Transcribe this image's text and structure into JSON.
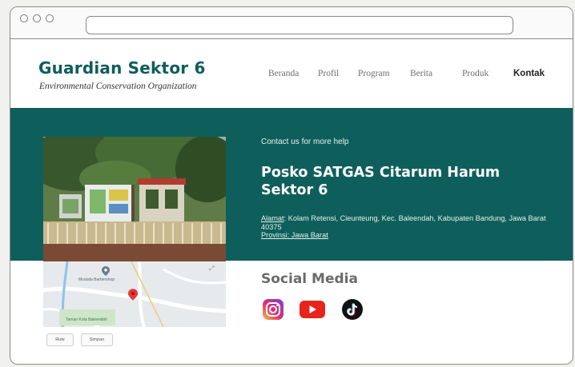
{
  "browser": {
    "window_buttons": [
      "close",
      "minimize",
      "maximize"
    ],
    "address_bar_value": ""
  },
  "header": {
    "title": "Guardian Sektor 6",
    "subtitle": "Environmental Conservation Organization",
    "nav": [
      {
        "label": "Beranda",
        "active": false
      },
      {
        "label": "Profil",
        "active": false
      },
      {
        "label": "Program",
        "active": false
      },
      {
        "label": "Berita",
        "active": false
      },
      {
        "label": "Produk",
        "active": false
      },
      {
        "label": "Kontak",
        "active": true
      }
    ]
  },
  "contact": {
    "eyebrow": "Contact us for more help",
    "title": "Posko SATGAS Citarum Harum Sektor 6",
    "address_label": "Alamat",
    "address_value": ": Kolam Retensi, Cieunteung, Kec. Baleendah, Kabupaten Bandung, Jawa Barat 40375",
    "province_label": "Provinsi",
    "province_value": ": Jawa Barat"
  },
  "map": {
    "place_label": "Taman Kota Baleendah",
    "poi_label": "Mostafa Barbershop",
    "buttons": [
      "Rute",
      "Simpan"
    ]
  },
  "social": {
    "title": "Social Media",
    "icons": [
      "instagram-icon",
      "youtube-icon",
      "tiktok-icon"
    ]
  },
  "colors": {
    "brand_teal": "#0e5f5c",
    "brand_title": "#0d5d5a",
    "youtube_red": "#e5241b",
    "map_pin": "#e53935"
  }
}
